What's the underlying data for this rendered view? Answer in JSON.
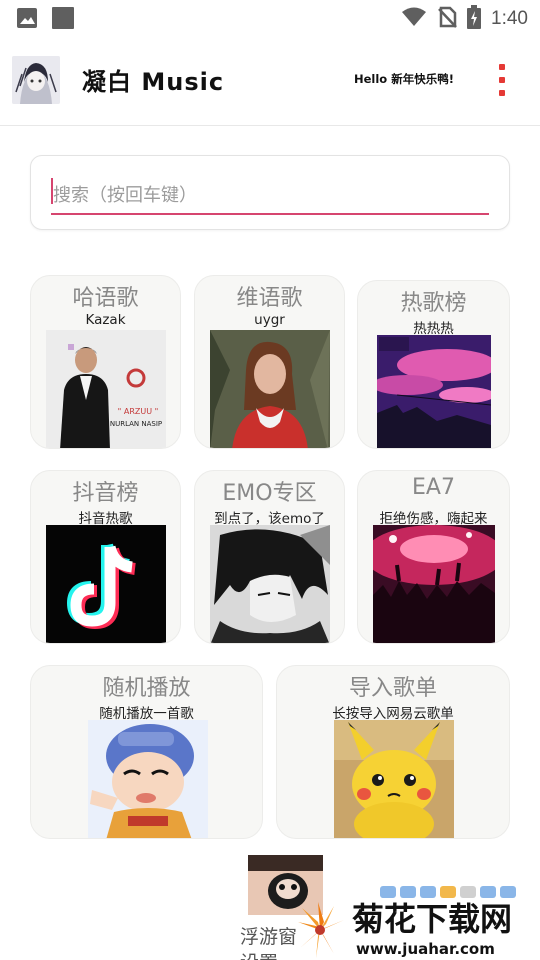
{
  "status_bar": {
    "time": "1:40",
    "icons": [
      "photo-icon",
      "square-icon",
      "wifi-icon",
      "no-sim-icon",
      "battery-charging-icon"
    ]
  },
  "header": {
    "title": "凝白 Music",
    "greeting": "Hello 新年快乐鸭!",
    "menu_icon": "more-vert-icon"
  },
  "search": {
    "placeholder": "搜索（按回车键）",
    "value": ""
  },
  "colors": {
    "accent": "#d6456f",
    "menu": "#e53935",
    "tile_bg": "#f7f7f5"
  },
  "categories": [
    {
      "title": "哈语歌",
      "subtitle": "Kazak",
      "image": "singer-cover"
    },
    {
      "title": "维语歌",
      "subtitle": "uygr",
      "image": "girl-photo"
    },
    {
      "title": "热歌榜",
      "subtitle": "热热热",
      "image": "pink-sky-art"
    },
    {
      "title": "抖音榜",
      "subtitle": "抖音热歌",
      "image": "tiktok-logo"
    },
    {
      "title": "EMO专区",
      "subtitle": "到点了，该emo了",
      "image": "emo-anime-boy"
    },
    {
      "title": "EA7",
      "subtitle": "拒绝伤感，嗨起来",
      "image": "concert-crowd"
    },
    {
      "title": "随机播放",
      "subtitle": "随机播放一首歌",
      "image": "cartoon-boy"
    },
    {
      "title": "导入歌单",
      "subtitle": "长按导入网易云歌单",
      "image": "pikachu"
    }
  ],
  "cover_text": {
    "album": "\" ARZUU \"",
    "artist": "NURLAN NASIP"
  },
  "floating": {
    "label_line1": "浮游窗",
    "label_line2": "设置"
  },
  "watermark": {
    "brand": "菊花下载网",
    "url": "www.juahar.com"
  }
}
